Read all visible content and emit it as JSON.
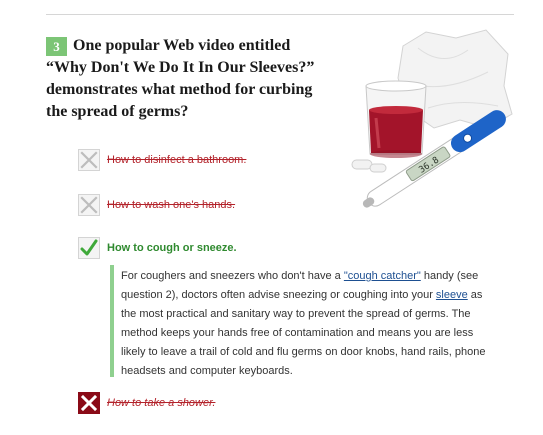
{
  "question": {
    "number": "3",
    "text": "One popular Web video entitled “Why Don't We Do It In Our Sleeves?” demonstrates what method for curbing the spread of germs?"
  },
  "options": [
    {
      "label": "How to disinfect a bathroom.",
      "state": "incorrect",
      "icon": "x-icon"
    },
    {
      "label": "How to wash one's hands.",
      "state": "incorrect",
      "icon": "x-icon"
    },
    {
      "label": "How to cough or sneeze.",
      "state": "correct",
      "icon": "checkmark-icon"
    },
    {
      "label": "How to take a shower.",
      "state": "selected-incorrect",
      "icon": "x-icon"
    }
  ],
  "explanation": {
    "part1": "For coughers and sneezers who don't have a ",
    "link1": "\"cough catcher\"",
    "part2": " handy (see question 2), doctors often advise sneezing or coughing into your ",
    "link2": "sleeve",
    "part3": " as the most practical and sanitary way to prevent the spread of germs. The method keeps your hands free of contamination and means you are less likely to leave a trail of cold and flu germs on door knobs, hand rails, phone headsets and computer keyboards."
  },
  "colors": {
    "accent_green": "#7cc576",
    "correct_text": "#2f8a2f",
    "incorrect_text": "#b3222a",
    "selected_wrong": "#8a0a17",
    "link": "#1d4f91"
  },
  "image": {
    "description_icons": [
      "medicine-cup-icon",
      "thermometer-icon",
      "tissue-icon",
      "pill-icon"
    ]
  }
}
